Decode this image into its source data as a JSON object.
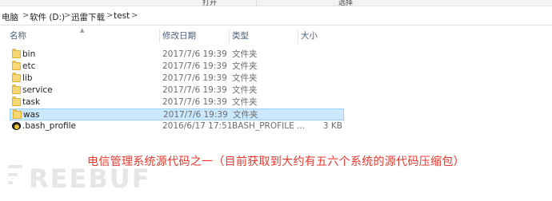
{
  "ribbon": {
    "labels": [
      "打开",
      "选择"
    ]
  },
  "breadcrumb": {
    "items": [
      "电脑",
      "软件 (D:)",
      "迅雷下载",
      "test"
    ]
  },
  "columns": {
    "name": "名称",
    "date": "修改日期",
    "type": "类型",
    "size": "大小"
  },
  "files": [
    {
      "name": "bin",
      "date": "2017/7/6 19:39",
      "type": "文件夹",
      "size": "",
      "icon": "folder-icon"
    },
    {
      "name": "etc",
      "date": "2017/7/6 19:39",
      "type": "文件夹",
      "size": "",
      "icon": "folder-icon"
    },
    {
      "name": "lib",
      "date": "2017/7/6 19:39",
      "type": "文件夹",
      "size": "",
      "icon": "folder-icon"
    },
    {
      "name": "service",
      "date": "2017/7/6 19:39",
      "type": "文件夹",
      "size": "",
      "icon": "folder-icon"
    },
    {
      "name": "task",
      "date": "2017/7/6 19:39",
      "type": "文件夹",
      "size": "",
      "icon": "folder-icon"
    },
    {
      "name": "was",
      "date": "2017/7/6 19:39",
      "type": "文件夹",
      "size": "",
      "icon": "folder-icon",
      "selected": true
    },
    {
      "name": ".bash_profile",
      "date": "2016/6/17 17:51",
      "type": "BASH_PROFILE ...",
      "size": "3 KB",
      "icon": "file-gear-icon"
    }
  ],
  "caption": "电信管理系统源代码之一（目前获取到大约有五六个系统的源代码压缩包）",
  "watermark": "REEBUF",
  "colors": {
    "selection": "#cce8ff",
    "selection_border": "#99d1ff",
    "caption": "#e6382d",
    "header_text": "#4c607a"
  }
}
